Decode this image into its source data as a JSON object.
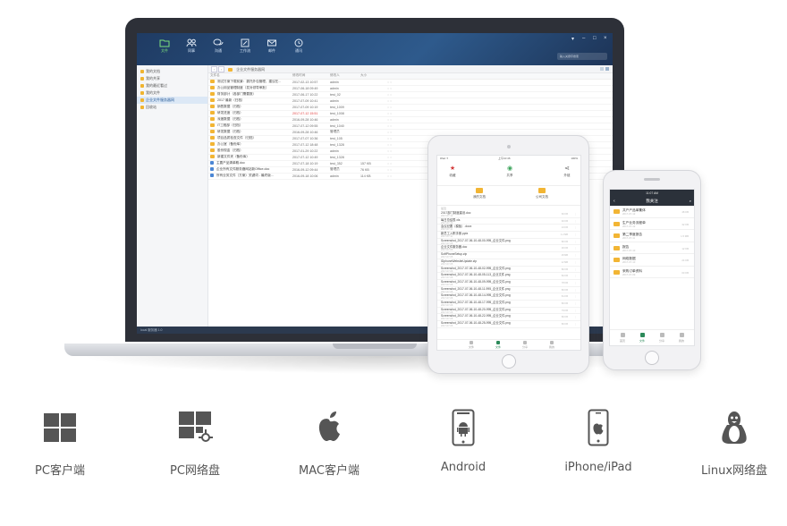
{
  "desktop_app": {
    "nav": [
      {
        "label": "文件",
        "icon": "folder-icon",
        "active": true
      },
      {
        "label": "同事",
        "icon": "people-icon"
      },
      {
        "label": "沟通",
        "icon": "chat-icon"
      },
      {
        "label": "工作流",
        "icon": "edit-icon"
      },
      {
        "label": "邮件",
        "icon": "mail-icon"
      },
      {
        "label": "通讯",
        "icon": "clock-icon"
      }
    ],
    "window_controls": {
      "pin": "▾",
      "min": "–",
      "max": "□",
      "close": "×"
    },
    "search_placeholder": "输入关键字搜索",
    "sidebar": [
      {
        "label": "我的文档"
      },
      {
        "label": "我的共享"
      },
      {
        "label": "我的最近看过"
      },
      {
        "label": "我的文件"
      },
      {
        "label": "企业文件服务器网",
        "active": true
      },
      {
        "label": "回收站"
      }
    ],
    "breadcrumb": "企业文件服务器网",
    "columns": [
      "文件名",
      "修改时间",
      "修改人",
      "大小"
    ],
    "files": [
      {
        "name": "测试方案下载前景：委托外包管理，建议在...",
        "time": "2017-02-13 10:57",
        "user": "admin",
        "size": ""
      },
      {
        "name": "办公用品管理制度（发对领导审批）",
        "time": "2017-06-18 09:49",
        "user": "admin",
        "size": ""
      },
      {
        "name": "财务部计（各部门需要报）",
        "time": "2017-06-17 10:22",
        "user": "test_02",
        "size": ""
      },
      {
        "name": "2017 最新（归档）",
        "time": "2017-07-09 10:41",
        "user": "admin",
        "size": ""
      },
      {
        "name": "销售数据（归档）",
        "time": "2017-07-09 10:19",
        "user": "test_1009",
        "size": ""
      },
      {
        "name": "研发进度（归档）",
        "time": "2017-07-12 15:51",
        "user": "test_1008",
        "size": "",
        "red": true
      },
      {
        "name": "深度数据（归档）",
        "time": "2016-09-28 10:46",
        "user": "admin",
        "size": ""
      },
      {
        "name": "IT工程部（归档）",
        "time": "2017-07-12 09:55",
        "user": "test_1040",
        "size": ""
      },
      {
        "name": "研发数据（归档）",
        "time": "2016-09-28 10:46",
        "user": "管理员",
        "size": ""
      },
      {
        "name": "项目品质检查文件（归档）",
        "time": "2017-07-07 10:36",
        "user": "test_105",
        "size": ""
      },
      {
        "name": "办公室（备份库）",
        "time": "2017-07-12 18:48",
        "user": "test_1328",
        "size": ""
      },
      {
        "name": "股份现金（归档）",
        "time": "2017-01-29 10:22",
        "user": "admin",
        "size": ""
      },
      {
        "name": "新建文件夹（备份库）",
        "time": "2017-07-12 10:49",
        "user": "test_1328",
        "size": ""
      },
      {
        "name": "主要产品清单概.doc",
        "time": "2017-07-18 10:19",
        "user": "test_352",
        "size": "157 KB",
        "doc": true
      },
      {
        "name": "企业所有文件服务器网站新Office.doc",
        "time": "2016-09-12 09:44",
        "user": "管理员",
        "size": "76 KB",
        "doc": true
      },
      {
        "name": "所有业务文件（方案）关键词 - 最终版...",
        "time": "2016-09-18 10:06",
        "user": "admin",
        "size": "114 KB",
        "doc": true
      }
    ],
    "status": "local 服务器 1.0"
  },
  "tablet_app": {
    "status_left": "iPad ✦",
    "status_mid": "上午10:46",
    "status_right": "100%",
    "actions": [
      {
        "label": "收藏",
        "glyph": "★",
        "color": "#d33a3a"
      },
      {
        "label": "共享",
        "glyph": "◉",
        "color": "#3aa35a"
      },
      {
        "label": "外链",
        "glyph": "⋖",
        "color": "#666666"
      }
    ],
    "folders": [
      {
        "label": "我的文档"
      },
      {
        "label": "公司文档"
      }
    ],
    "section": "最近",
    "rows": [
      {
        "name": "2017部门制度建设.doc",
        "date": "2017-07-12",
        "size": "60 KB"
      },
      {
        "name": "每日总结表.xls",
        "date": "2017-07-12",
        "size": "92 KB"
      },
      {
        "name": "会议纪要（模板）.docx",
        "date": "2017-07-11",
        "size": "24 KB"
      },
      {
        "name": "新员工入职手册.pptx",
        "date": "2017-07-11",
        "size": "1.2 MB"
      },
      {
        "name": "Screenshot_2017-07-06-10-48-00-995_企业文件.png",
        "date": "2017-07-06",
        "size": "80 KB"
      },
      {
        "name": "企业文件服务器.doc",
        "date": "2017-07-06",
        "size": "36 KB"
      },
      {
        "name": "SoftPhoneSetup.zip",
        "date": "2017-07-05",
        "size": "18 MB"
      },
      {
        "name": "IDphoneWebsiteUpdate.zip",
        "date": "2017-07-05",
        "size": "12 MB"
      },
      {
        "name": "Screenshot_2017-07-06-10-48-02-995_企业文件.png",
        "date": "2017-07-06",
        "size": "80 KB"
      },
      {
        "name": "Screenshot_2017-07-06-10-48-05-113_企业文件.png",
        "date": "2017-07-06",
        "size": "82 KB"
      },
      {
        "name": "Screenshot_2017-07-06-10-48-09-995_企业文件.png",
        "date": "2017-07-06",
        "size": "78 KB"
      },
      {
        "name": "Screenshot_2017-07-06-10-48-11-995_企业文件.png",
        "date": "2017-07-06",
        "size": "80 KB"
      },
      {
        "name": "Screenshot_2017-07-06-10-48-14-995_企业文件.png",
        "date": "2017-07-06",
        "size": "81 KB"
      },
      {
        "name": "Screenshot_2017-07-06-10-48-17-995_企业文件.png",
        "date": "2017-07-06",
        "size": "80 KB"
      },
      {
        "name": "Screenshot_2017-07-06-10-48-20-995_企业文件.png",
        "date": "2017-07-06",
        "size": "79 KB"
      },
      {
        "name": "Screenshot_2017-07-06-10-48-22-995_企业文件.png",
        "date": "2017-07-06",
        "size": "80 KB"
      },
      {
        "name": "Screenshot_2017-07-06-10-48-25-995_企业文件.png",
        "date": "2017-07-06",
        "size": "80 KB"
      }
    ],
    "tabs": [
      {
        "label": "文件"
      },
      {
        "label": "文件",
        "active": true
      },
      {
        "label": "分享"
      },
      {
        "label": "我的"
      }
    ]
  },
  "phone_app": {
    "status": "11:07 AM",
    "title": "我关注",
    "rows": [
      {
        "name": "共产产品单集体",
        "date": "2017-07-12",
        "size": "48 KB"
      },
      {
        "name": "生产业务流程单",
        "date": "2017-07-12",
        "size": "32 KB"
      },
      {
        "name": "第二季度报告",
        "date": "2017-07-11",
        "size": "1.5 MB"
      },
      {
        "name": "报告",
        "date": "2017-07-10",
        "size": "12 KB"
      },
      {
        "name": "网络数据",
        "date": "2017-07-10",
        "size": "24 KB"
      },
      {
        "name": "采购订单资料",
        "date": "2017-07-09",
        "size": "60 KB"
      }
    ],
    "tabs": [
      {
        "label": "首页"
      },
      {
        "label": "文件",
        "active": true
      },
      {
        "label": "分享"
      },
      {
        "label": "我的"
      }
    ]
  },
  "platforms": [
    {
      "label": "PC客户端",
      "icon": "windows-icon"
    },
    {
      "label": "PC网络盘",
      "icon": "windows-network-drive-icon"
    },
    {
      "label": "MAC客户端",
      "icon": "apple-icon"
    },
    {
      "label": "Android",
      "icon": "android-phone-icon"
    },
    {
      "label": "iPhone/iPad",
      "icon": "iphone-icon"
    },
    {
      "label": "Linux网络盘",
      "icon": "linux-penguin-icon"
    }
  ],
  "colors": {
    "header_blue": "#2e5a8c",
    "active_green": "#7de07d",
    "folder_yellow": "#f2b534",
    "icon_gray": "#555555",
    "label_gray": "#555555"
  }
}
